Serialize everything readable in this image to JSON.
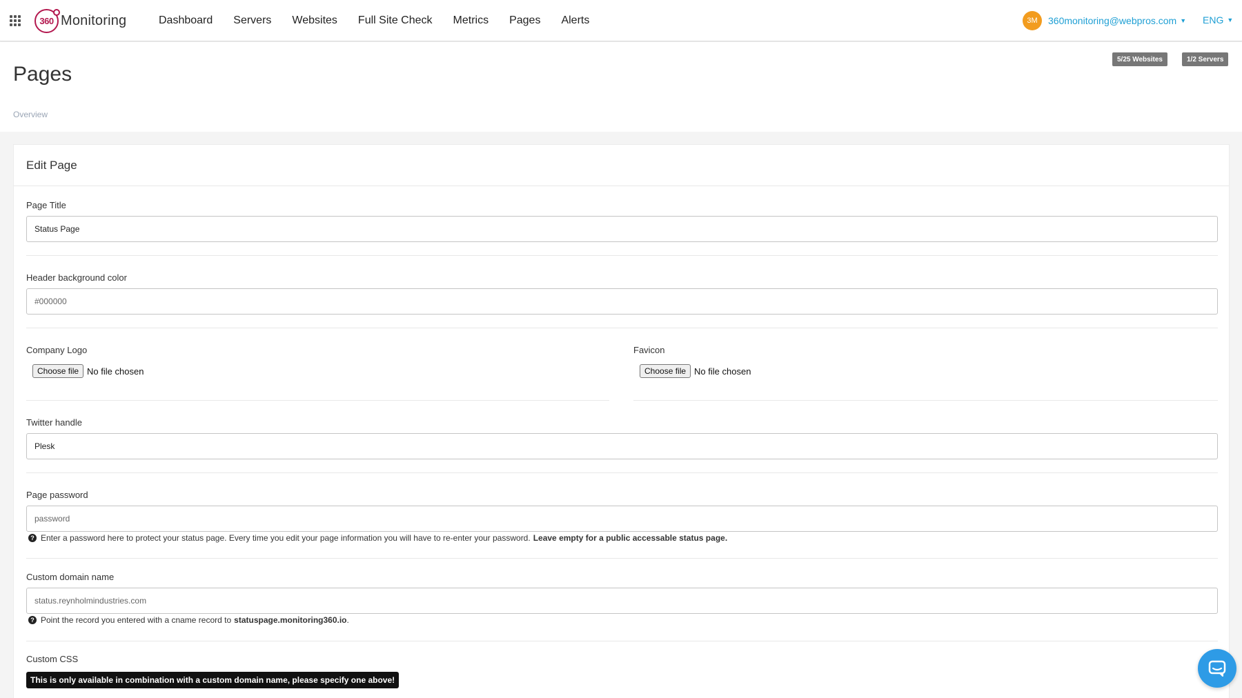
{
  "app": {
    "name": "Monitoring",
    "logo_text": "360"
  },
  "nav": [
    {
      "label": "Dashboard"
    },
    {
      "label": "Servers"
    },
    {
      "label": "Websites"
    },
    {
      "label": "Full Site Check"
    },
    {
      "label": "Metrics"
    },
    {
      "label": "Pages"
    },
    {
      "label": "Alerts"
    }
  ],
  "user": {
    "initials": "3M",
    "email": "360monitoring@webpros.com",
    "avatar_color": "#f29c1f"
  },
  "language": "ENG",
  "accent_color": "#1e9fd4",
  "quota": {
    "websites": "5/25 Websites",
    "servers": "1/2 Servers"
  },
  "page": {
    "title": "Pages",
    "breadcrumb": "Overview"
  },
  "card": {
    "title": "Edit Page"
  },
  "form": {
    "page_title": {
      "label": "Page Title",
      "value": "Status Page"
    },
    "header_bg": {
      "label": "Header background color",
      "placeholder": "#000000"
    },
    "company_logo": {
      "label": "Company Logo",
      "button": "Choose file",
      "status": "No file chosen"
    },
    "favicon": {
      "label": "Favicon",
      "button": "Choose file",
      "status": "No file chosen"
    },
    "twitter": {
      "label": "Twitter handle",
      "value": "Plesk"
    },
    "password": {
      "label": "Page password",
      "placeholder": "password",
      "help": "Enter a password here to protect your status page. Every time you edit your page information you will have to re-enter your password.",
      "help_bold": "Leave empty for a public accessable status page."
    },
    "domain": {
      "label": "Custom domain name",
      "placeholder": "status.reynholmindustries.com",
      "help": "Point the record you entered with a cname record to",
      "help_bold": "statuspage.monitoring360.io",
      "help_end": "."
    },
    "custom_css": {
      "label": "Custom CSS",
      "warning": "This is only available in combination with a custom domain name, please specify one above!"
    }
  },
  "icons": {
    "apps": "grid-icon",
    "chat": "chat-bubble-icon",
    "help": "question-circle-icon"
  }
}
